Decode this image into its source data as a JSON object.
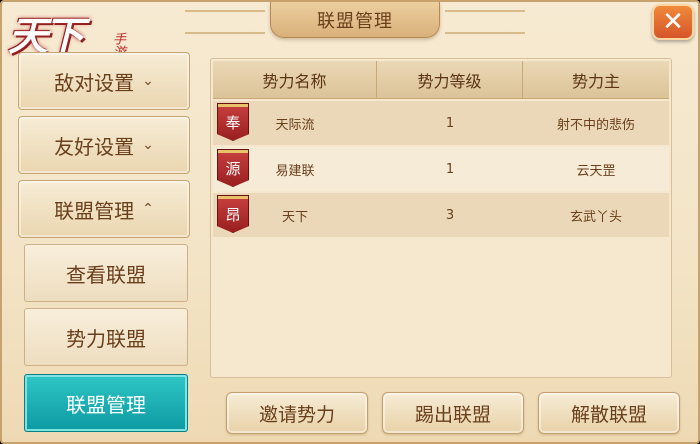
{
  "logo": {
    "main": "天下",
    "sub": "手游"
  },
  "window": {
    "title": "联盟管理",
    "close_label": "✕"
  },
  "menu": {
    "items": [
      {
        "label": "敌对设置",
        "chevron": "⌄"
      },
      {
        "label": "友好设置",
        "chevron": "⌄"
      },
      {
        "label": "联盟管理",
        "chevron": "⌃"
      }
    ],
    "sub_items": [
      {
        "label": "查看联盟"
      },
      {
        "label": "势力联盟"
      },
      {
        "label": "联盟管理"
      }
    ]
  },
  "table": {
    "headers": [
      "势力名称",
      "势力等级",
      "势力主"
    ],
    "rows": [
      {
        "badge": "奉",
        "name": "天际流",
        "level": "1",
        "leader": "射不中的悲伤"
      },
      {
        "badge": "源",
        "name": "易建联",
        "level": "1",
        "leader": "云天罡"
      },
      {
        "badge": "昂",
        "name": "天下",
        "level": "3",
        "leader": "玄武丫头"
      }
    ]
  },
  "actions": {
    "invite": "邀请势力",
    "kick": "踢出联盟",
    "dissolve": "解散联盟"
  },
  "colors": {
    "accent_active": "#0c9aa2",
    "badge_red": "#9a1f1f",
    "close_orange": "#d6552a",
    "text_brown": "#6a3f1b"
  }
}
